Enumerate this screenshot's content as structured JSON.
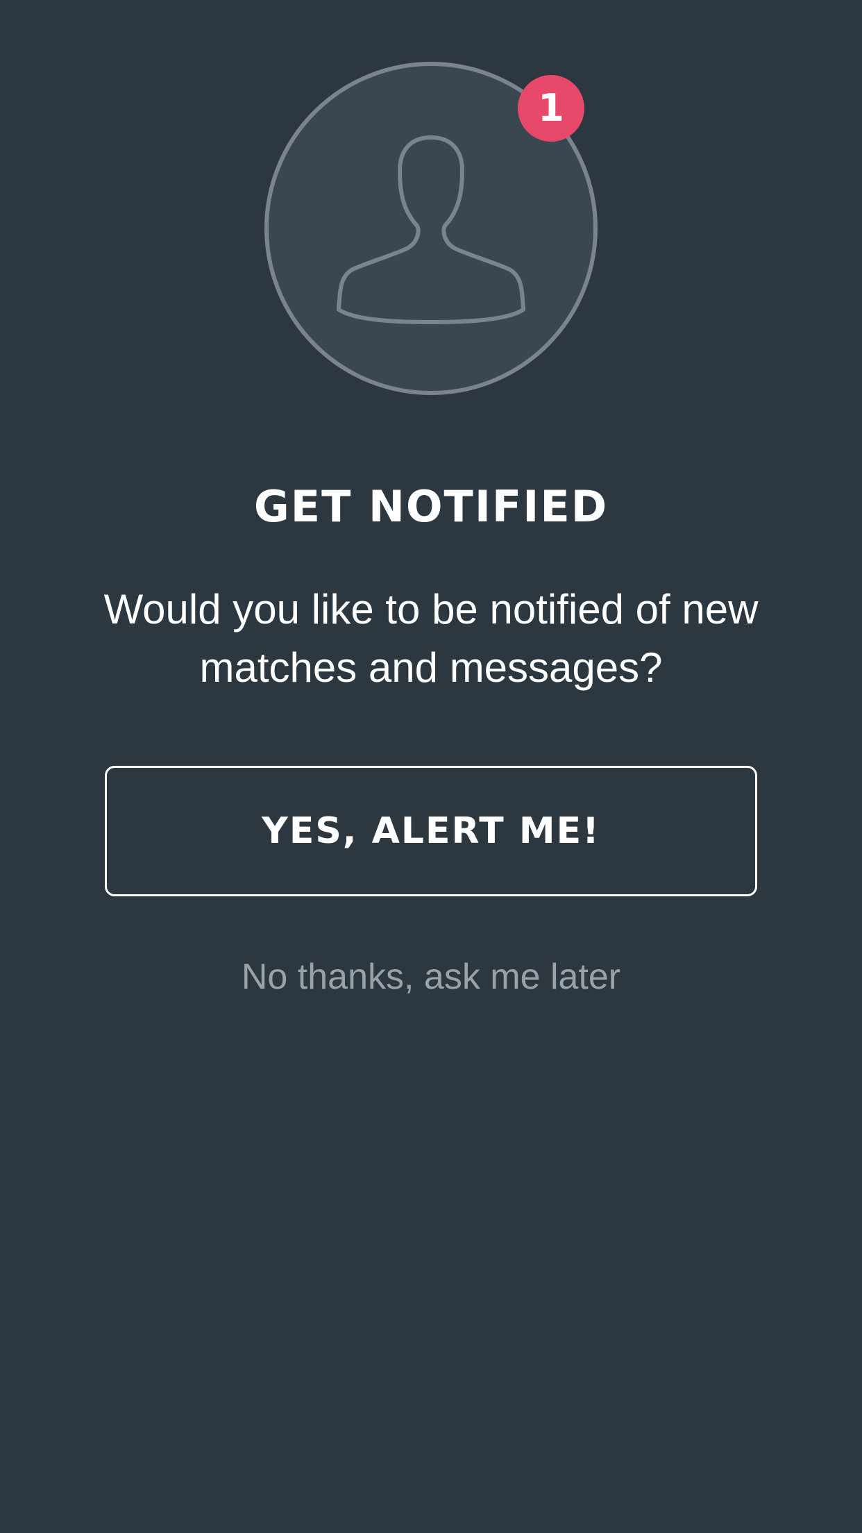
{
  "colors": {
    "background": "#2c3740",
    "avatar_fill": "#3a4650",
    "avatar_stroke": "#7b848c",
    "badge": "#e8486a",
    "text_primary": "#ffffff",
    "text_muted": "#9aa2a9"
  },
  "avatar": {
    "icon": "user-silhouette-icon",
    "badge_count": "1"
  },
  "prompt": {
    "title": "GET NOTIFIED",
    "message": "Would you like to be notified of new matches and messages?"
  },
  "actions": {
    "confirm_label": "YES, ALERT ME!",
    "dismiss_label": "No thanks, ask me later"
  }
}
